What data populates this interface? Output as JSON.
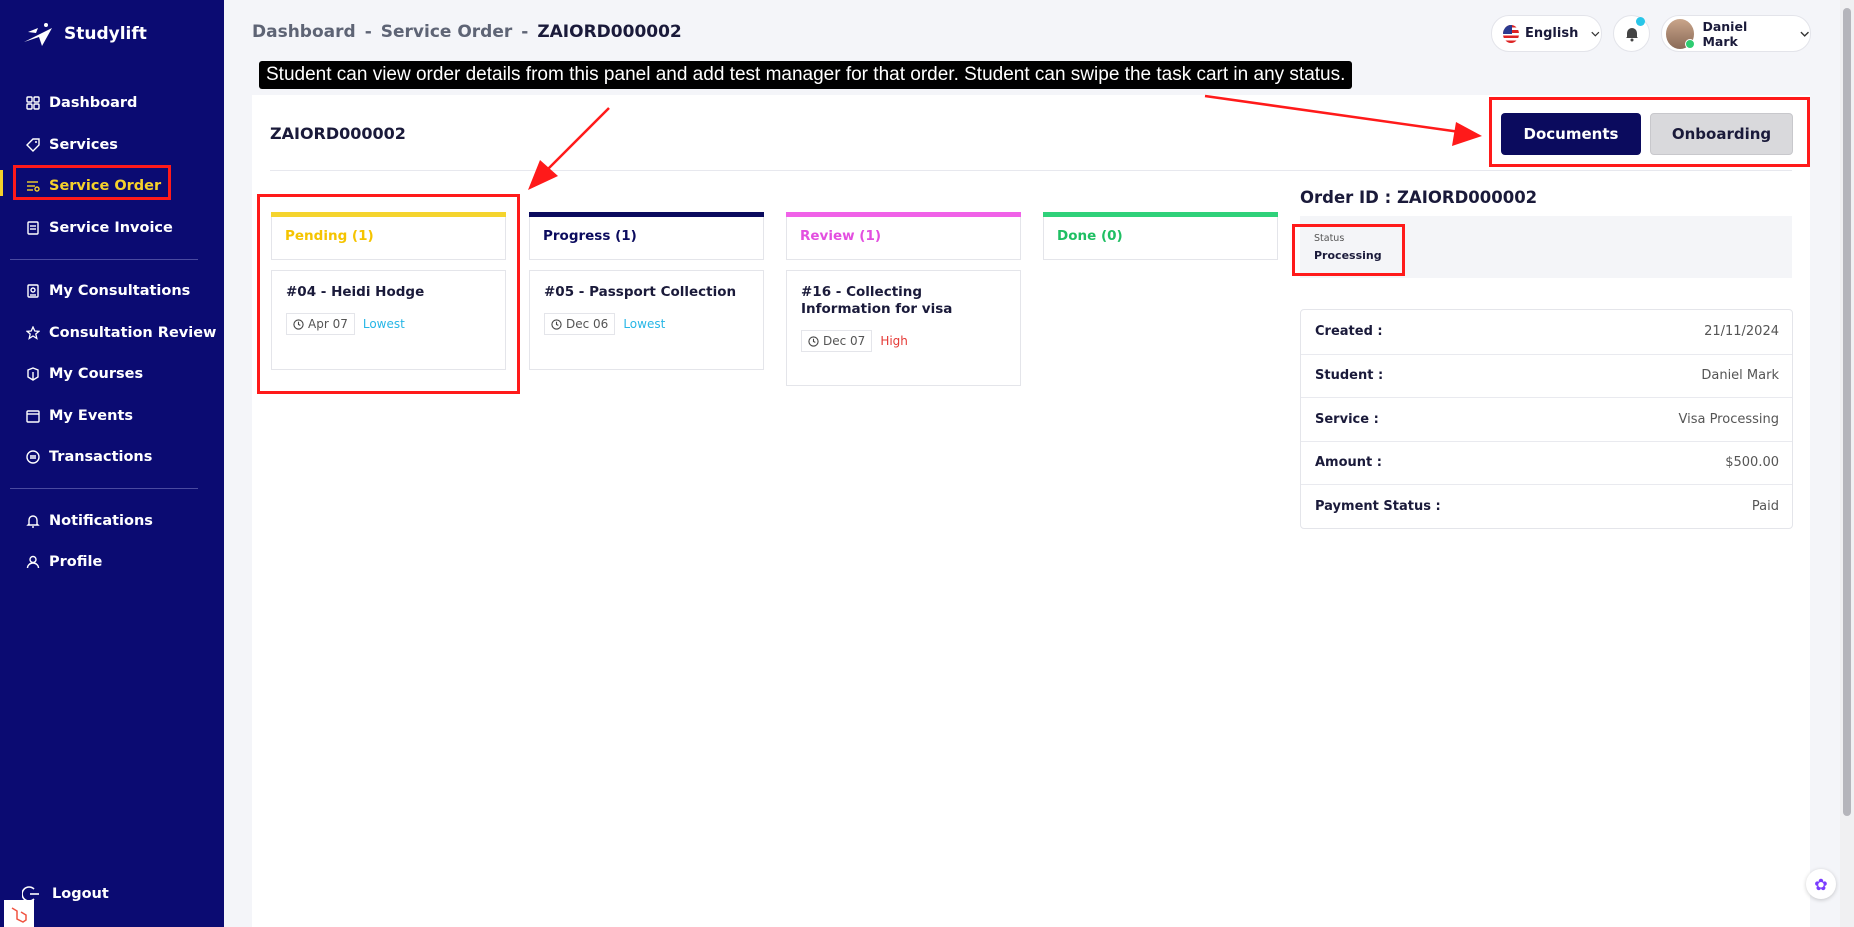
{
  "app": {
    "name": "Studylift"
  },
  "sidebar": {
    "items": [
      {
        "label": "Dashboard",
        "icon": "grid-icon"
      },
      {
        "label": "Services",
        "icon": "tag-icon"
      },
      {
        "label": "Service Order",
        "icon": "list-icon"
      },
      {
        "label": "Service Invoice",
        "icon": "invoice-icon"
      },
      {
        "label": "My Consultations",
        "icon": "consultation-icon"
      },
      {
        "label": "Consultation Review",
        "icon": "star-icon"
      },
      {
        "label": "My Courses",
        "icon": "course-icon"
      },
      {
        "label": "My Events",
        "icon": "calendar-icon"
      },
      {
        "label": "Transactions",
        "icon": "transactions-icon"
      },
      {
        "label": "Notifications",
        "icon": "bell-icon"
      },
      {
        "label": "Profile",
        "icon": "user-icon"
      }
    ],
    "active": "Service Order",
    "logout": "Logout"
  },
  "breadcrumb": {
    "home": "Dashboard",
    "sep": "-",
    "section": "Service Order",
    "current": "ZAIORD000002"
  },
  "header": {
    "language": "English",
    "user_name": "Daniel Mark"
  },
  "tooltip": "Student can view order details from this panel and add test manager for that order. Student can swipe the task cart in any status.",
  "order": {
    "title": "ZAIORD000002",
    "buttons": {
      "documents": "Documents",
      "onboarding": "Onboarding"
    }
  },
  "kanban": {
    "columns": [
      {
        "label": "Pending (1)",
        "color": "#f5d42e",
        "text_color": "#f5c400"
      },
      {
        "label": "Progress (1)",
        "color": "#0b0b5e",
        "text_color": "#0b0b5e"
      },
      {
        "label": "Review (1)",
        "color": "#f062e8",
        "text_color": "#e34fe0"
      },
      {
        "label": "Done (0)",
        "color": "#2fd17a",
        "text_color": "#1fbf63"
      }
    ],
    "cards": [
      {
        "title": "#04 - Heidi Hodge",
        "date": "Apr 07",
        "priority": "Lowest",
        "priority_color": "#27b6e6"
      },
      {
        "title": "#05 - Passport Collection",
        "date": "Dec 06",
        "priority": "Lowest",
        "priority_color": "#27b6e6"
      },
      {
        "title": "#16 - Collecting Information for visa",
        "date": "Dec 07",
        "priority": "High",
        "priority_color": "#e53935"
      }
    ]
  },
  "details": {
    "order_id_label": "Order ID : ZAIORD000002",
    "status_label": "Status",
    "status_value": "Processing",
    "rows": [
      {
        "key": "Created :",
        "value": "21/11/2024"
      },
      {
        "key": "Student :",
        "value": "Daniel Mark"
      },
      {
        "key": "Service :",
        "value": "Visa Processing"
      },
      {
        "key": "Amount :",
        "value": "$500.00"
      },
      {
        "key": "Payment Status :",
        "value": "Paid"
      }
    ]
  }
}
